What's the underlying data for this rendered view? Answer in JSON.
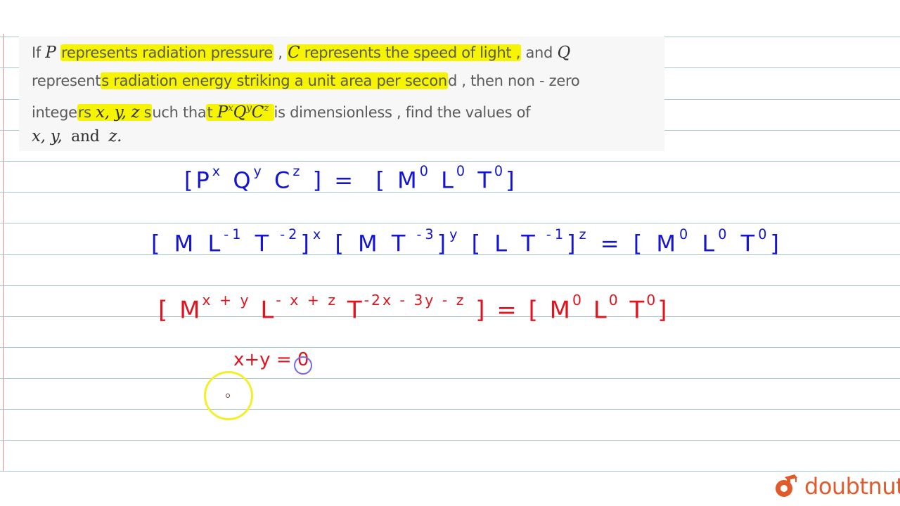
{
  "question": {
    "line1": {
      "pre": "If ",
      "P": "P",
      "hl1": "represents radiation pressure",
      "mid1": " , ",
      "C": "C",
      "hl2": " represents the speed of light ,",
      "mid2": " and ",
      "Q": "Q"
    },
    "line2": {
      "pre": "represent",
      "hl": "s radiation energy striking a unit area per secon",
      "post": "d , then non - zero"
    },
    "line3": {
      "pre": "intege",
      "hl_a": "rs x, y, z s",
      "mid": "uch tha",
      "hl_b": "t PˣQʸCᶻ ",
      "expr_base_P": "P",
      "expr_exp_x": "x",
      "expr_base_Q": "Q",
      "expr_exp_y": "y",
      "expr_base_C": "C",
      "expr_exp_z": "z",
      "post": "is dimensionless , find the values of"
    },
    "line4": {
      "vars": "x, y,",
      "and": "and",
      "z": "z."
    }
  },
  "handwriting": {
    "eq1": {
      "lhs": "[P",
      "lhs_x": "x",
      "lhs_Q": " Q",
      "lhs_y": "y",
      "lhs_C": " C",
      "lhs_z": "z",
      "lhs_close": " ] =",
      "rhs": "[ M",
      "rhs_m": "0",
      "rhs_L": " L",
      "rhs_l": "0",
      "rhs_T": "  T",
      "rhs_t": "0",
      "rhs_close": "]"
    },
    "eq2": {
      "t1": "[ M L",
      "t1_l": "-1",
      "t1_T": " T",
      "t1_t": " -2",
      "t1_close": "]",
      "t1_exp": "x",
      "t2": " [ M T",
      "t2_t": " -3",
      "t2_close": "]",
      "t2_exp": "y",
      "t3": " [ L T",
      "t3_t": " -1",
      "t3_close": "]",
      "t3_exp": "z",
      "eq": " = ",
      "rhs": "[ M",
      "rhs_m": "0",
      "rhs_L": " L",
      "rhs_l": "0",
      "rhs_T": "  T",
      "rhs_t": "0",
      "rhs_close": "]"
    },
    "eq3": {
      "open": "[",
      "M": "  M",
      "M_exp": "x + y",
      "L": "   L",
      "L_exp": "- x + z",
      "T": "    T",
      "T_exp": "-2x - 3y - z",
      "close": " ] =",
      "rhs": " [ M",
      "rhs_m": "0",
      "rhs_L": " L",
      "rhs_l": "0",
      "rhs_T": " T",
      "rhs_t": "0",
      "rhs_close": "]"
    },
    "eq4": "x+y = 0"
  },
  "brand": {
    "name": "doubtnut",
    "color": "#e05a2b"
  },
  "colors": {
    "highlight": "#f7f400",
    "ink_blue": "#1414d4",
    "ink_red": "#e0141e",
    "rule": "#a9c8cc",
    "margin": "#d98a8a"
  }
}
